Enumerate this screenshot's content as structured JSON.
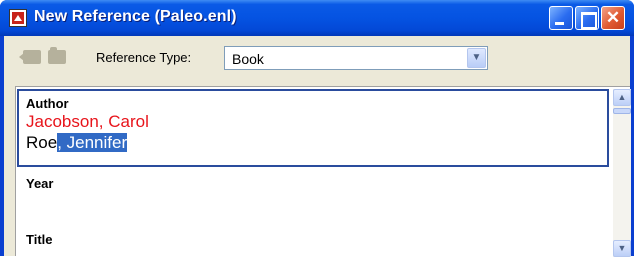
{
  "window": {
    "title": "New Reference (Paleo.enl)",
    "icon": "endnote-app-icon",
    "controls": {
      "minimize_icon": "minimize-icon",
      "maximize_icon": "maximize-icon",
      "close_glyph": "✕"
    }
  },
  "toolbar": {
    "icons": [
      "back-arrow-icon",
      "folder-icon"
    ],
    "reference_type_label": "Reference Type:",
    "reference_type_value": "Book",
    "dropdown_arrow": "⌄"
  },
  "fields": {
    "author": {
      "label": "Author",
      "entries": [
        "Jacobson, Carol",
        "Roe, Jennifer"
      ],
      "entry2_plain": "Roe",
      "entry2_selected": ", Jennifer"
    },
    "year": {
      "label": "Year"
    },
    "title": {
      "label": "Title"
    }
  },
  "scrollbar": {
    "up_glyph": "▲",
    "down_glyph": "▼"
  },
  "colors": {
    "titlebar": "#0553e2",
    "frame": "#ece9d8",
    "author_primary": "#e8141b",
    "selection": "#316ac5",
    "focus_border": "#2a4c9d"
  }
}
